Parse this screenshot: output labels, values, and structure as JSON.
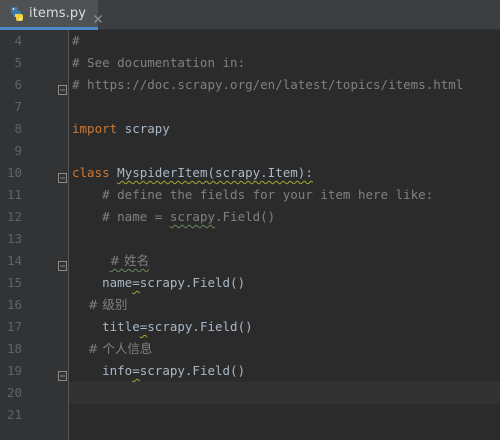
{
  "tab": {
    "filename": "items.py",
    "icon": "python-file-icon",
    "close": "close-icon"
  },
  "colors": {
    "background": "#2b2b2b",
    "gutter": "#313335",
    "comment": "#808080",
    "keyword": "#cc7832",
    "text": "#a9b7c6",
    "line_number": "#606366",
    "tab_accent": "#4a88c7"
  },
  "lines": [
    {
      "num": "4",
      "parts": [
        {
          "t": "#",
          "c": "comment"
        }
      ]
    },
    {
      "num": "5",
      "parts": [
        {
          "t": "# See documentation in:",
          "c": "comment"
        }
      ]
    },
    {
      "num": "6",
      "parts": [
        {
          "t": "# https://doc.scrapy.org/en/latest/topics/items.html",
          "c": "comment"
        }
      ]
    },
    {
      "num": "7",
      "parts": []
    },
    {
      "num": "8",
      "parts": [
        {
          "t": "import",
          "c": "kw"
        },
        {
          "t": " scrapy",
          "c": "plain"
        }
      ]
    },
    {
      "num": "9",
      "parts": []
    },
    {
      "num": "10",
      "parts": [
        {
          "t": "class",
          "c": "kw"
        },
        {
          "t": " ",
          "c": "plain"
        },
        {
          "t": "MyspiderItem(scrapy.Item):",
          "c": "plain",
          "squiggle": true
        }
      ]
    },
    {
      "num": "11",
      "parts": [
        {
          "t": "    # define the fields for your item here like:",
          "c": "comment"
        }
      ]
    },
    {
      "num": "12",
      "parts": [
        {
          "t": "    # name = ",
          "c": "comment"
        },
        {
          "t": "scrapy",
          "c": "comment",
          "squiggle": true
        },
        {
          "t": ".Field()",
          "c": "comment"
        }
      ]
    },
    {
      "num": "13",
      "parts": []
    },
    {
      "num": "14",
      "parts": [
        {
          "t": "     ",
          "c": "plain"
        },
        {
          "t": "# 姓名",
          "c": "comment",
          "squiggle": true,
          "ch": true
        }
      ]
    },
    {
      "num": "15",
      "parts": [
        {
          "t": "    name",
          "c": "plain"
        },
        {
          "t": "=",
          "c": "plain",
          "squiggle": true
        },
        {
          "t": "scrapy.Field()",
          "c": "plain"
        }
      ]
    },
    {
      "num": "16",
      "parts": [
        {
          "t": "    # 级别",
          "c": "comment",
          "ch": true
        }
      ]
    },
    {
      "num": "17",
      "parts": [
        {
          "t": "    title",
          "c": "plain"
        },
        {
          "t": "=",
          "c": "plain",
          "squiggle": true
        },
        {
          "t": "scrapy.Field()",
          "c": "plain"
        }
      ]
    },
    {
      "num": "18",
      "parts": [
        {
          "t": "    # 个人信息",
          "c": "comment",
          "ch": true
        }
      ]
    },
    {
      "num": "19",
      "parts": [
        {
          "t": "    info",
          "c": "plain"
        },
        {
          "t": "=",
          "c": "plain",
          "squiggle": true
        },
        {
          "t": "scrapy.Field()",
          "c": "plain"
        }
      ]
    },
    {
      "num": "20",
      "parts": [],
      "current": true
    },
    {
      "num": "21",
      "parts": []
    }
  ],
  "folds": [
    "6",
    "10",
    "14",
    "19"
  ]
}
